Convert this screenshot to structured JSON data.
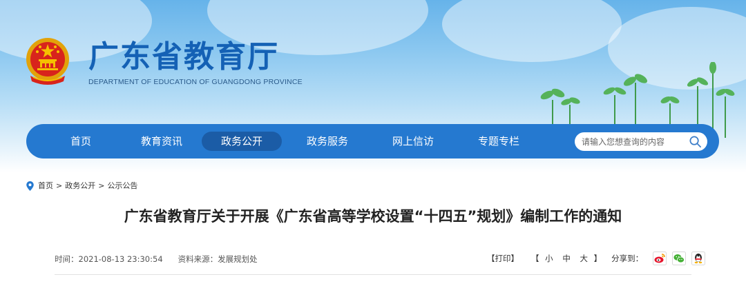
{
  "header": {
    "title": "广东省教育厅",
    "subtitle": "DEPARTMENT OF EDUCATION OF GUANGDONG PROVINCE"
  },
  "nav": {
    "items": [
      {
        "label": "首页"
      },
      {
        "label": "教育资讯"
      },
      {
        "label": "政务公开",
        "active": true
      },
      {
        "label": "政务服务"
      },
      {
        "label": "网上信访"
      },
      {
        "label": "专题专栏"
      }
    ],
    "search_placeholder": "请输入您想查询的内容"
  },
  "breadcrumb": {
    "items": [
      "首页",
      "政务公开",
      "公示公告"
    ],
    "separator": ">"
  },
  "article": {
    "title": "广东省教育厅关于开展《广东省高等学校设置“十四五”规划》编制工作的通知",
    "time": "时间：2021-08-13 23:30:54",
    "source": "资料来源：发展规划处"
  },
  "tools": {
    "print": "【打印】",
    "size_open": "【",
    "size_small": "小",
    "size_medium": "中",
    "size_large": "大",
    "size_close": "】",
    "share_label": "分享到：",
    "share_icons": [
      "weibo-icon",
      "wechat-icon",
      "qq-icon"
    ]
  },
  "colors": {
    "brand_blue": "#1461b5",
    "nav_bg": "#2579d0",
    "nav_active": "#1b5ca6",
    "title_text": "#222222"
  }
}
